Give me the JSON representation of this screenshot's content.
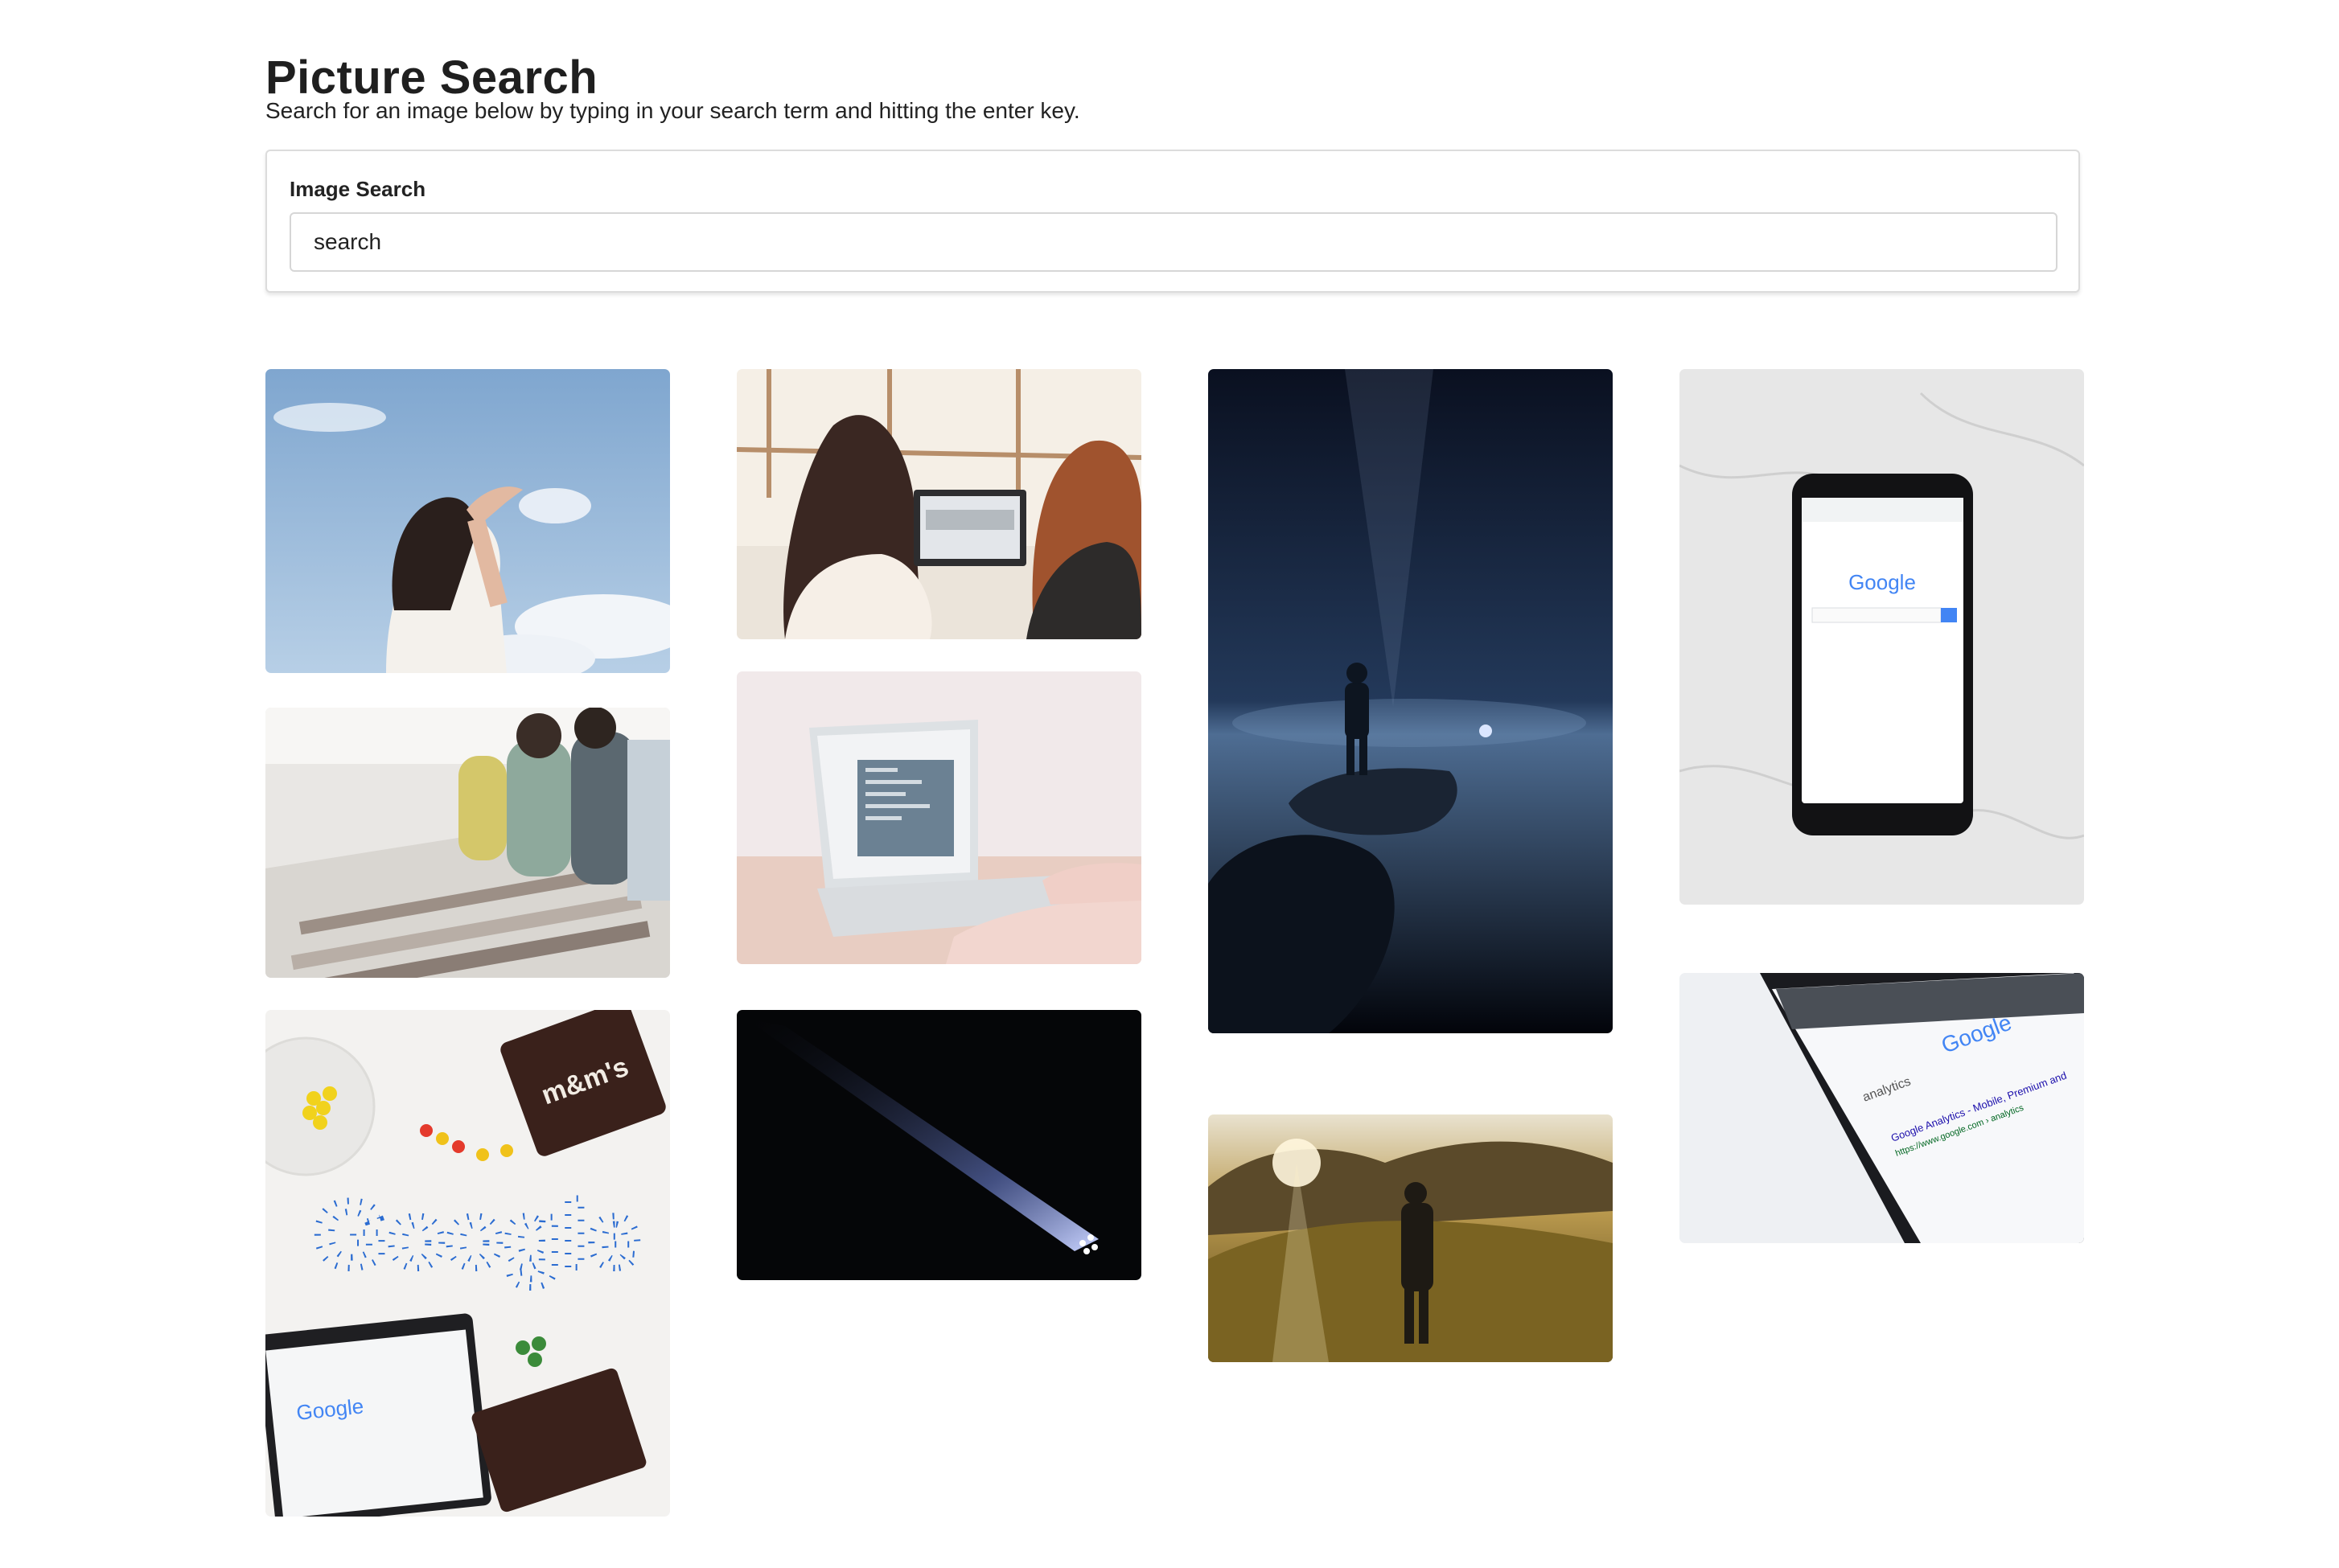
{
  "page": {
    "title": "Picture Search",
    "subtitle": "Search for an image below by typing in your search term and hitting the enter key."
  },
  "search": {
    "label": "Image Search",
    "value": "search"
  },
  "results": {
    "items": [
      {
        "subject": "woman-shading-eyes-sky"
      },
      {
        "subject": "two-women-at-laptop"
      },
      {
        "subject": "man-with-flashlight-on-rock-at-night"
      },
      {
        "subject": "smartphone-google-on-marble"
      },
      {
        "subject": "people-browsing-records"
      },
      {
        "subject": "hands-typing-on-laptop"
      },
      {
        "subject": "light-beam-in-dark"
      },
      {
        "subject": "man-on-hill-at-sunset"
      },
      {
        "subject": "google-candy-letters-with-laptop"
      },
      {
        "subject": "smartphone-google-analytics-search"
      }
    ],
    "phone_screen_text": {
      "logo": "Google",
      "query": "analytics",
      "result_title": "Google Analytics - Mobile, Premium and",
      "result_url": "https://www.google.com › analytics",
      "candy_logo": "Google",
      "candy_brand": "m&m's"
    }
  }
}
